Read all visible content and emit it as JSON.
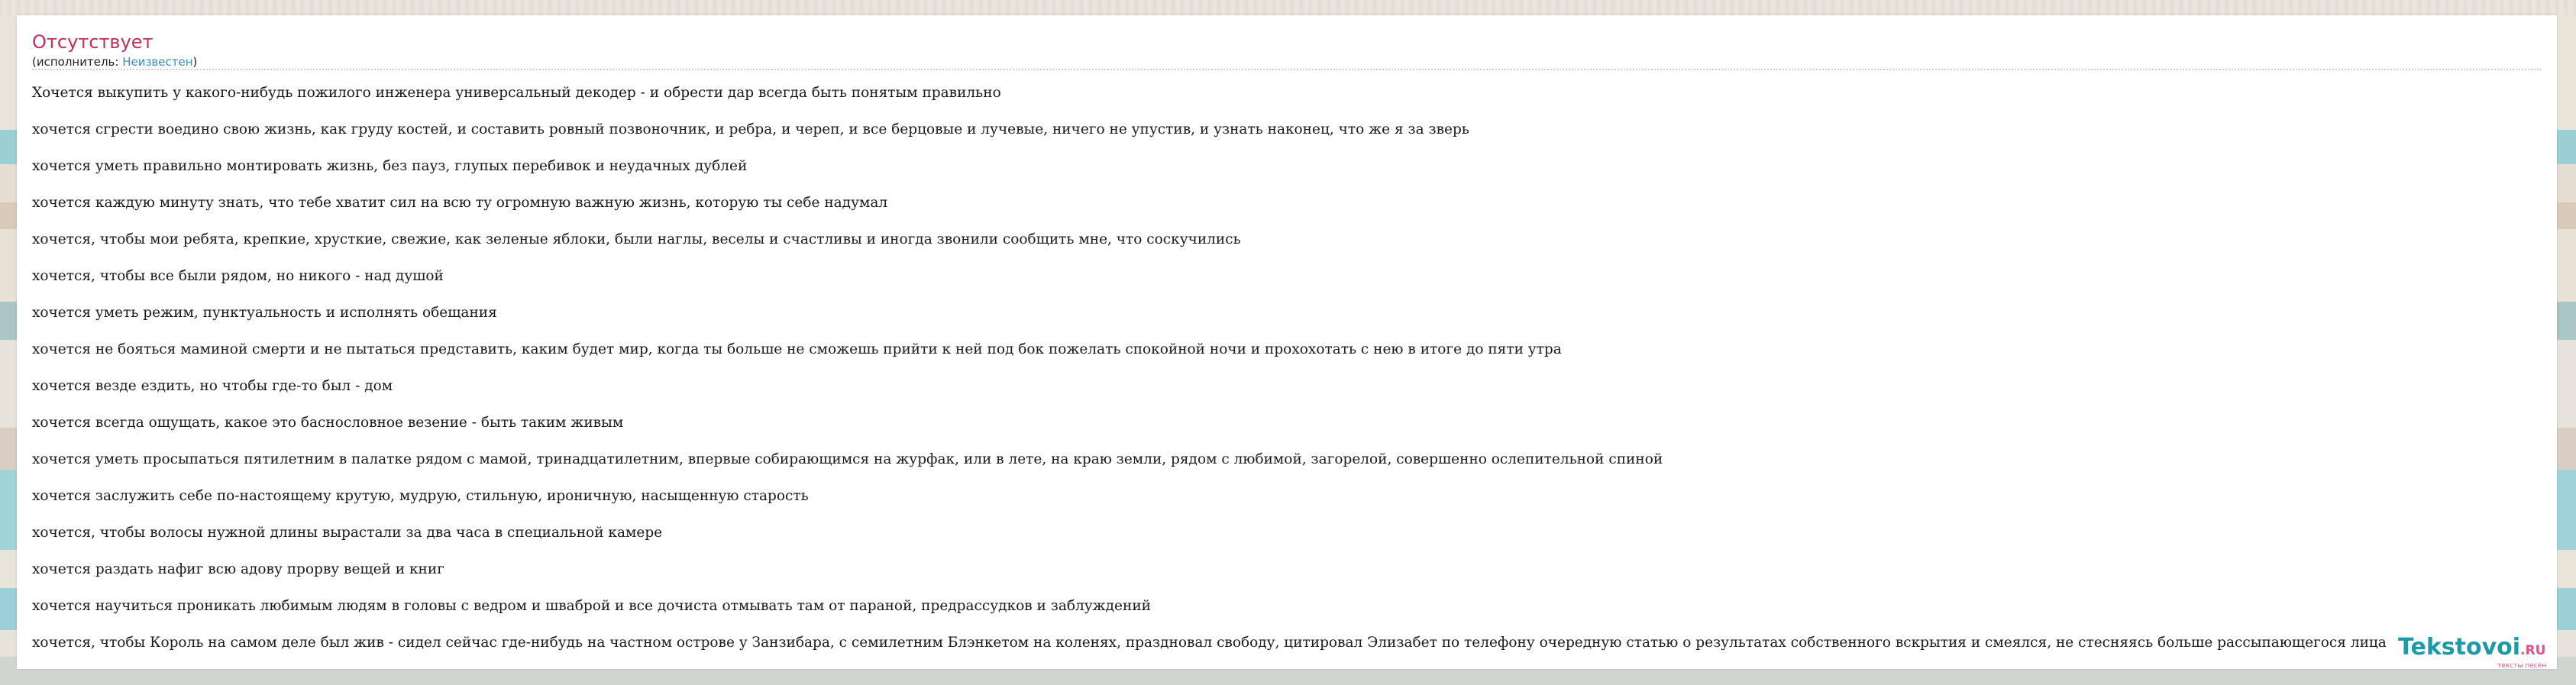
{
  "song": {
    "title": "Отсутствует",
    "performer_prefix": "(исполнитель: ",
    "performer_name": "Неизвестен",
    "performer_suffix": ")"
  },
  "lyrics": [
    "Хочется выкупить у какого-нибудь пожилого инженера универсальный декодер - и обрести дар всегда быть понятым правильно",
    "хочется сгрести воедино свою жизнь, как груду костей, и составить ровный позвоночник, и ребра, и череп, и все берцовые и лучевые, ничего не упустив, и узнать наконец, что же я за зверь",
    "хочется уметь правильно монтировать жизнь, без пауз, глупых перебивок и неудачных дублей",
    "хочется каждую минуту знать, что тебе хватит сил на всю ту огромную важную жизнь, которую ты себе надумал",
    "хочется, чтобы мои ребята, крепкие, хрусткие, свежие, как зеленые яблоки, были наглы, веселы и счастливы и иногда звонили сообщить мне, что соскучились",
    "хочется, чтобы все были рядом, но никого - над душой",
    "хочется уметь режим, пунктуальность и исполнять обещания",
    "хочется не бояться маминой смерти и не пытаться представить, каким будет мир, когда ты больше не сможешь прийти к ней под бок пожелать спокойной ночи и прохохотать с нею в итоге до пяти утра",
    "хочется везде ездить, но чтобы где-то был - дом",
    "хочется всегда ощущать, какое это баснословное везение - быть таким живым",
    "хочется уметь просыпаться пятилетним в палатке рядом с мамой, тринадцатилетним, впервые собирающимся на журфак, или в лете, на краю земли, рядом с любимой, загорелой, совершенно ослепительной спиной",
    "хочется заслужить себе по-настоящему крутую, мудрую, стильную, ироничную, насыщенную старость",
    "хочется, чтобы волосы нужной длины вырастали за два часа в специальной камере",
    "хочется раздать нафиг всю адову прорву вещей и книг",
    "хочется научиться проникать любимым людям в головы с ведром и шваброй и все дочиста отмывать там от параной, предрассудков и заблуждений",
    "хочется, чтобы Король на самом деле был жив - сидел сейчас где-нибудь на частном острове у Занзибара, с семилетним Блэнкетом на коленях, праздновал свободу, цитировал Элизабет по телефону очередную статью о результатах собственного вскрытия и смеялся, не стесняясь больше рассыпающегося лица"
  ],
  "watermark": {
    "brand": "Tekstovoi",
    "tld": ".RU",
    "tagline": "тексты песен"
  }
}
